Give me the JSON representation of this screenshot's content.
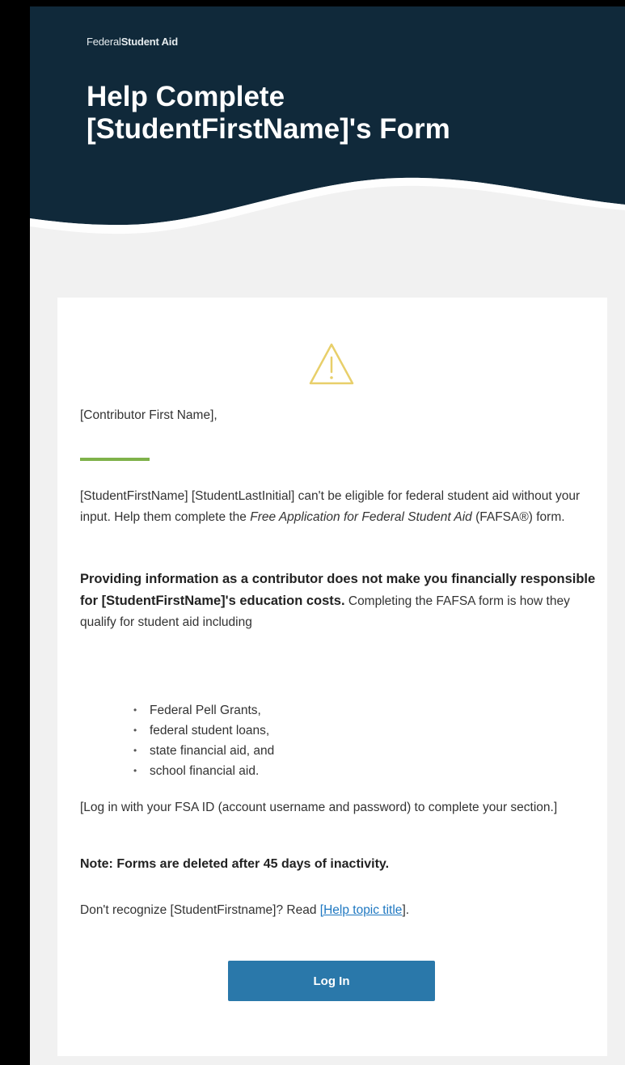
{
  "header": {
    "brand_light": "Federal",
    "brand_bold": "Student Aid",
    "title_line1": "Help Complete",
    "title_line2": "[StudentFirstName]'s Form"
  },
  "body": {
    "greeting": "[Contributor First Name],",
    "p1_a": "[StudentFirstName] [StudentLastInitial] can't be eligible for federal student aid without your input. Help them complete the ",
    "p1_em": "Free Application for Federal Student Aid",
    "p1_b": " (FAFSA®) form.",
    "p2_strong": "Providing information as a contributor does not make you financially responsible for [StudentFirstName]'s education costs.",
    "p2_rest": " Completing the FAFSA form is how they qualify for student aid including",
    "bullets": [
      "Federal Pell Grants,",
      "federal student loans,",
      "state financial aid, and",
      "school financial aid."
    ],
    "p3": "[Log in with your FSA ID (account username and password) to complete your section.]",
    "note": "Note: Forms are deleted after 45 days of inactivity.",
    "p4_text": "Don't recognize [StudentFirstname]? Read ",
    "p4_open": "[",
    "p4_link": "Help topic title",
    "p4_close": "].",
    "login_label": "Log In"
  },
  "colors": {
    "header_bg": "#10293a",
    "accent_green": "#7fb24a",
    "button_blue": "#2a78aa",
    "link_blue": "#1f78c1",
    "warning_yellow": "#e8cf6a"
  },
  "icons": {
    "warning": "warning-triangle-icon"
  }
}
